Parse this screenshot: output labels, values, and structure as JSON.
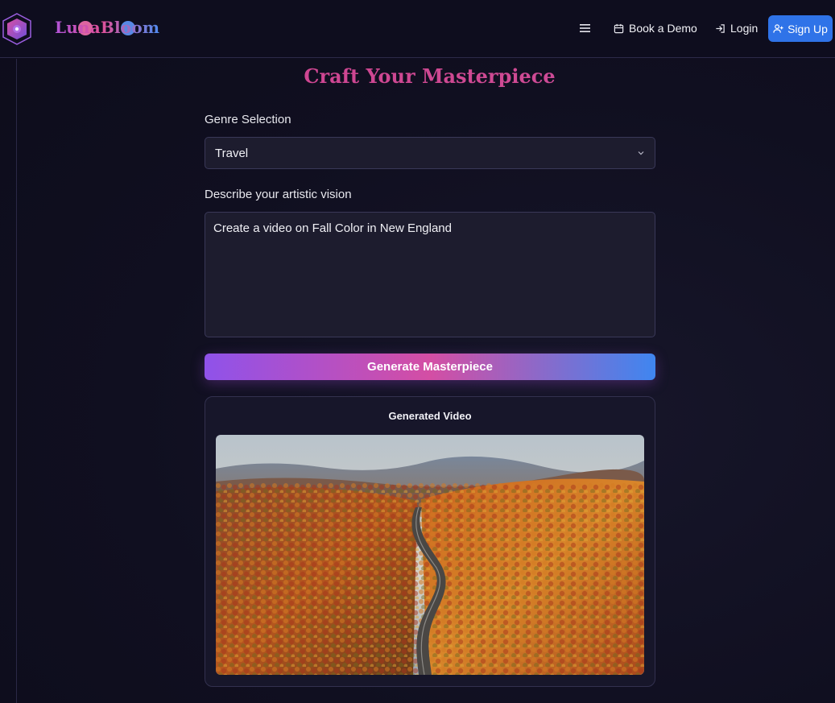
{
  "header": {
    "brand": "LunaBloom",
    "nav": {
      "book_demo": "Book a Demo",
      "login": "Login",
      "signup": "Sign Up"
    }
  },
  "main": {
    "title": "Craft Your Masterpiece",
    "genre": {
      "label": "Genre Selection",
      "selected": "Travel"
    },
    "vision": {
      "label": "Describe your artistic vision",
      "value": "Create a video on Fall Color in New England"
    },
    "generate_button": "Generate Masterpiece",
    "video_card": {
      "title": "Generated Video"
    }
  },
  "colors": {
    "accent_blue": "#2f73e8",
    "title_pink": "#cc3f8f",
    "gradient_start": "#8f52ea",
    "gradient_mid": "#d44ea4",
    "gradient_end": "#3f86f0"
  },
  "icons": [
    "logo-hexagon-icon",
    "hamburger-menu-icon",
    "calendar-icon",
    "login-arrow-icon",
    "user-plus-icon",
    "chevron-down-icon"
  ]
}
